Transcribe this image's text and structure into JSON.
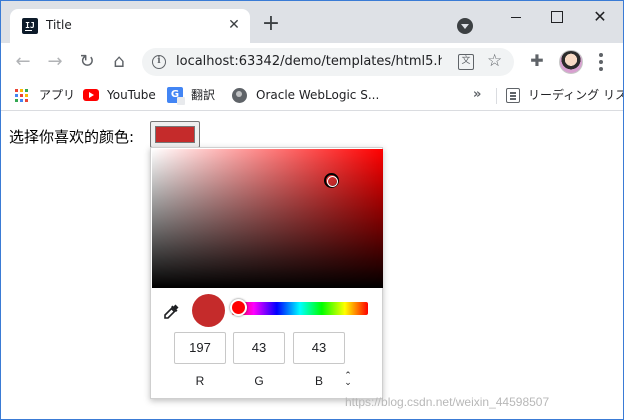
{
  "browser": {
    "tab": {
      "title": "Title",
      "favicon_icon": "intellij-icon"
    },
    "url": "localhost:63342/demo/templates/html5.h...",
    "bookmarks": [
      {
        "label": "アプリ",
        "icon": "apps-grid-icon"
      },
      {
        "label": "YouTube",
        "icon": "youtube-icon"
      },
      {
        "label": "翻訳",
        "icon": "google-translate-icon"
      },
      {
        "label": "Oracle WebLogic S...",
        "icon": "globe-icon"
      }
    ],
    "reading_list_label": "リーディング リスト",
    "more_bookmarks": "»"
  },
  "page": {
    "label": "选择你喜欢的颜色:",
    "selected_color": "#c52b2b"
  },
  "picker": {
    "preview_color": "#c52b2b",
    "hue_color": "#ff0000",
    "channels": [
      {
        "label": "R",
        "value": "197"
      },
      {
        "label": "G",
        "value": "43"
      },
      {
        "label": "B",
        "value": "43"
      }
    ],
    "format_toggle": "⌃⌄"
  },
  "watermark": "https://blog.csdn.net/weixin_44598507"
}
